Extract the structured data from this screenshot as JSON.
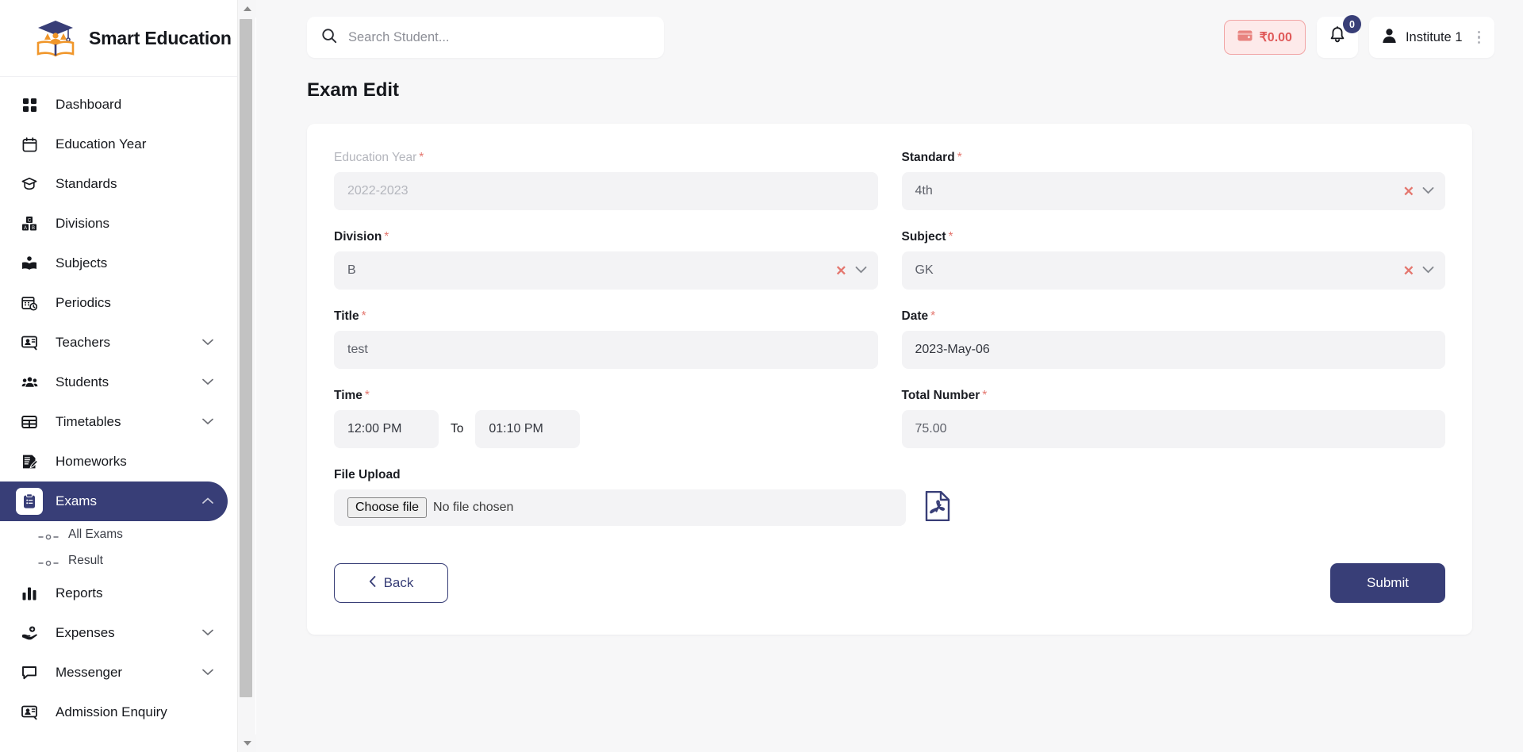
{
  "brand": {
    "name": "Smart Education",
    "logo_icon": "graduation-book-logo"
  },
  "sidebar": {
    "items": [
      {
        "label": "Dashboard",
        "icon": "grid-icon",
        "expandable": false
      },
      {
        "label": "Education Year",
        "icon": "calendar-icon",
        "expandable": false
      },
      {
        "label": "Standards",
        "icon": "graduation-cap-icon",
        "expandable": false
      },
      {
        "label": "Divisions",
        "icon": "blocks-abc-icon",
        "expandable": false
      },
      {
        "label": "Subjects",
        "icon": "open-book-person-icon",
        "expandable": false
      },
      {
        "label": "Periodics",
        "icon": "calendar-clock-icon",
        "expandable": false
      },
      {
        "label": "Teachers",
        "icon": "presenter-icon",
        "expandable": true
      },
      {
        "label": "Students",
        "icon": "people-group-icon",
        "expandable": true
      },
      {
        "label": "Timetables",
        "icon": "table-icon",
        "expandable": true
      },
      {
        "label": "Homeworks",
        "icon": "document-pen-icon",
        "expandable": false
      },
      {
        "label": "Exams",
        "icon": "clipboard-list-icon",
        "expandable": true,
        "active": true,
        "children": [
          {
            "label": "All Exams"
          },
          {
            "label": "Result"
          }
        ]
      },
      {
        "label": "Reports",
        "icon": "bar-chart-icon",
        "expandable": false
      },
      {
        "label": "Expenses",
        "icon": "hand-coins-icon",
        "expandable": true
      },
      {
        "label": "Messenger",
        "icon": "chat-bubble-icon",
        "expandable": true
      },
      {
        "label": "Admission Enquiry",
        "icon": "presenter-icon",
        "expandable": false
      }
    ]
  },
  "topbar": {
    "search": {
      "placeholder": "Search Student...",
      "value": "",
      "icon": "search-icon"
    },
    "wallet": {
      "amount": "₹0.00",
      "icon": "wallet-icon"
    },
    "notifications": {
      "count": "0",
      "icon": "bell-icon"
    },
    "user": {
      "name": "Institute 1",
      "icon": "user-icon",
      "menu_icon": "kebab-menu-icon"
    }
  },
  "page": {
    "title": "Exam Edit"
  },
  "form": {
    "education_year": {
      "label": "Education Year",
      "required": true,
      "value": "2022-2023",
      "disabled": true
    },
    "standard": {
      "label": "Standard",
      "required": true,
      "value": "4th",
      "clear_icon": "clear-x-icon",
      "chevron_icon": "chevron-down-icon"
    },
    "division": {
      "label": "Division",
      "required": true,
      "value": "B",
      "clear_icon": "clear-x-icon",
      "chevron_icon": "chevron-down-icon"
    },
    "subject": {
      "label": "Subject",
      "required": true,
      "value": "GK",
      "clear_icon": "clear-x-icon",
      "chevron_icon": "chevron-down-icon"
    },
    "title": {
      "label": "Title",
      "required": true,
      "value": "test"
    },
    "date": {
      "label": "Date",
      "required": true,
      "value": "2023-May-06"
    },
    "time": {
      "label": "Time",
      "required": true,
      "from": "12:00 PM",
      "to_label": "To",
      "to": "01:10 PM"
    },
    "total_number": {
      "label": "Total Number",
      "required": true,
      "value": "75.00"
    },
    "file_upload": {
      "label": "File Upload",
      "choose_button": "Choose file",
      "status": "No file chosen",
      "attachment_icon": "pdf-file-icon"
    },
    "required_marker": "*"
  },
  "actions": {
    "back": {
      "label": "Back",
      "icon": "chevron-left-icon"
    },
    "submit": {
      "label": "Submit"
    }
  },
  "colors": {
    "accent": "#383e77",
    "required": "#e4776f",
    "wallet_text": "#e05a5a",
    "wallet_bg": "#fdeaea",
    "page_bg": "#f7f7f8",
    "input_bg": "#f3f3f5"
  }
}
